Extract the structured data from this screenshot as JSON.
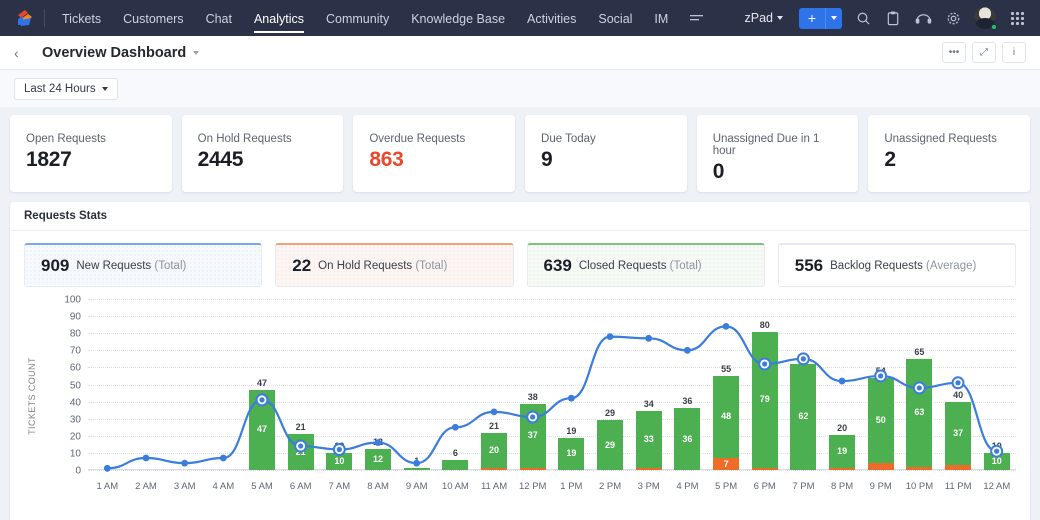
{
  "topnav": {
    "logo_icon": "zoho-logo-icon",
    "items": [
      {
        "label": "Tickets",
        "active": false
      },
      {
        "label": "Customers",
        "active": false
      },
      {
        "label": "Chat",
        "active": false
      },
      {
        "label": "Analytics",
        "active": true
      },
      {
        "label": "Community",
        "active": false
      },
      {
        "label": "Knowledge Base",
        "active": false
      },
      {
        "label": "Activities",
        "active": false
      },
      {
        "label": "Social",
        "active": false
      },
      {
        "label": "IM",
        "active": false
      }
    ],
    "hamburger_icon": "more-menu-icon",
    "zpad_label": "zPad",
    "add_button_label": "+",
    "add_dropdown_icon": "chevron-down-icon",
    "icons": [
      "search-icon",
      "notes-icon",
      "headset-icon",
      "gear-icon"
    ],
    "avatar": "user-avatar",
    "apps_icon": "apps-grid-icon",
    "accent": "#2e74e8",
    "bg": "#2b3147"
  },
  "dashboard_header": {
    "back_icon": "back-chevron-icon",
    "title": "Overview Dashboard",
    "title_caret_icon": "chevron-down-icon",
    "actions": [
      {
        "name": "more-options-button",
        "glyph": "•••"
      },
      {
        "name": "expand-button",
        "glyph": "⤢"
      },
      {
        "name": "info-button",
        "glyph": "i"
      }
    ]
  },
  "filter": {
    "label": "Last 24 Hours",
    "caret_icon": "chevron-down-icon"
  },
  "kpis": [
    {
      "label": "Open Requests",
      "value": "1827",
      "danger": false
    },
    {
      "label": "On Hold Requests",
      "value": "2445",
      "danger": false
    },
    {
      "label": "Overdue Requests",
      "value": "863",
      "danger": true
    },
    {
      "label": "Due Today",
      "value": "9",
      "danger": false
    },
    {
      "label": "Unassigned Due in 1 hour",
      "value": "0",
      "danger": false
    },
    {
      "label": "Unassigned Requests",
      "value": "2",
      "danger": false
    }
  ],
  "panel": {
    "title": "Requests Stats",
    "summary": [
      {
        "value": "909",
        "label": "New Requests",
        "qualifier": "(Total)",
        "accent": "#7ba7ec",
        "bg": "#f6f9fe"
      },
      {
        "value": "22",
        "label": "On Hold Requests",
        "qualifier": "(Total)",
        "accent": "#f0a277",
        "bg": "#fdf5f1"
      },
      {
        "value": "639",
        "label": "Closed Requests",
        "qualifier": "(Total)",
        "accent": "#7dc47d",
        "bg": "#f5faf5"
      },
      {
        "value": "556",
        "label": "Backlog Requests",
        "qualifier": "(Average)",
        "accent": "#e6eaf0",
        "bg": "#ffffff"
      }
    ]
  },
  "chart_data": {
    "type": "bar",
    "title": "Requests Stats",
    "xlabel": "",
    "ylabel": "TICKETS COUNT",
    "ylim": [
      0,
      100
    ],
    "yticks": [
      0,
      10,
      20,
      30,
      40,
      50,
      60,
      70,
      80,
      90,
      100
    ],
    "grid": true,
    "legend_position": "none",
    "categories": [
      "1 AM",
      "2 AM",
      "3 AM",
      "4 AM",
      "5 AM",
      "6 AM",
      "7 AM",
      "8 AM",
      "9 AM",
      "10 AM",
      "11 AM",
      "12 PM",
      "1 PM",
      "2 PM",
      "3 PM",
      "4 PM",
      "5 PM",
      "6 PM",
      "7 PM",
      "8 PM",
      "9 PM",
      "10 PM",
      "11 PM",
      "12 AM"
    ],
    "series": [
      {
        "name": "Closed Requests",
        "type": "bar-segment",
        "color": "#4caf50",
        "values": [
          0,
          0,
          0,
          0,
          47,
          21,
          10,
          12,
          1,
          6,
          20,
          37,
          19,
          29,
          33,
          36,
          48,
          79,
          62,
          19,
          50,
          63,
          37,
          10
        ]
      },
      {
        "name": "On Hold Requests",
        "type": "bar-segment",
        "color": "#ef6c28",
        "values": [
          0,
          0,
          0,
          0,
          0,
          0,
          0,
          0,
          0,
          0,
          1,
          1,
          0,
          0,
          1,
          0,
          7,
          1,
          0,
          1,
          4,
          2,
          3,
          0
        ]
      },
      {
        "name": "New Requests",
        "type": "line",
        "color": "#3b7ddd",
        "values": [
          1,
          7,
          4,
          7,
          41,
          14,
          12,
          16,
          4,
          25,
          34,
          31,
          42,
          78,
          77,
          70,
          84,
          62,
          65,
          52,
          55,
          48,
          51,
          11
        ]
      }
    ],
    "bar_totals": [
      0,
      0,
      0,
      0,
      47,
      21,
      10,
      12,
      1,
      6,
      21,
      38,
      19,
      29,
      34,
      36,
      55,
      80,
      62,
      20,
      54,
      65,
      40,
      10
    ],
    "highlighted_points": [
      "5 AM",
      "6 AM",
      "7 AM",
      "12 PM",
      "6 PM",
      "7 PM",
      "9 PM",
      "10 PM",
      "11 PM",
      "12 AM"
    ]
  }
}
